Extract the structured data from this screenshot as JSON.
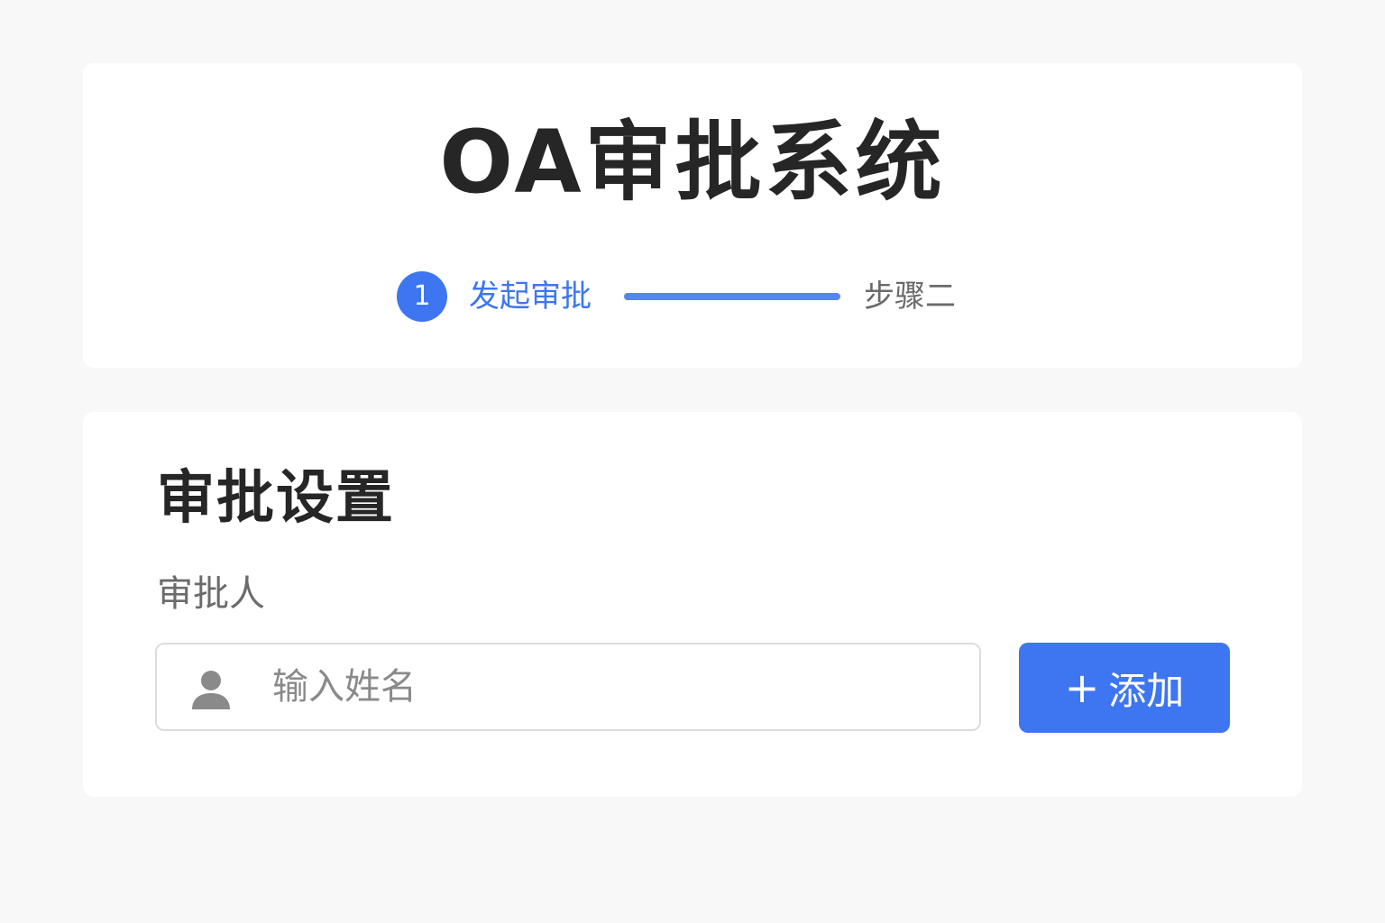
{
  "header": {
    "title": "OA审批系统"
  },
  "stepper": {
    "steps": [
      {
        "number": "1",
        "label": "发起审批",
        "state": "active"
      },
      {
        "label": "步骤二",
        "state": "pending"
      }
    ],
    "active_color": "#3d76f0",
    "pending_color": "#6a6a6a"
  },
  "approval_settings": {
    "title": "审批设置",
    "approver_label": "审批人",
    "approver_input": {
      "value": "",
      "placeholder": "输入姓名",
      "icon": "user-icon"
    },
    "add_button": {
      "icon": "plus-icon",
      "icon_glyph": "+",
      "label": "添加",
      "color": "#3d76f0"
    }
  }
}
